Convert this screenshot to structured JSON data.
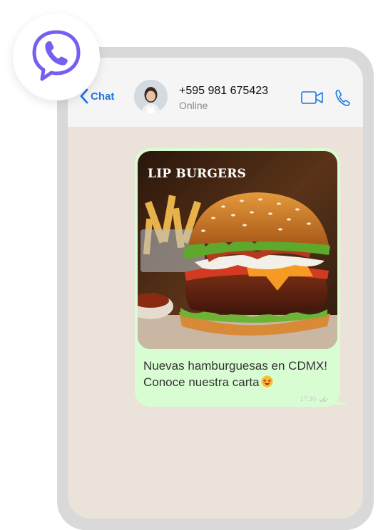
{
  "header": {
    "back_label": "Chat",
    "contact_name": "+595 981 675423",
    "contact_status": "Online"
  },
  "message": {
    "image_title": "LIP BURGERS",
    "text": "Nuevas hamburguesas en CDMX! Conoce nuestra carta",
    "time": "17:30"
  },
  "icons": {
    "app_logo": "viber-style-phone-bubble-icon",
    "back": "chevron-left-icon",
    "video": "video-camera-icon",
    "call": "phone-icon",
    "emoji": "star-struck-emoji-icon",
    "read_receipt": "double-check-icon"
  },
  "colors": {
    "accent": "#7360f2",
    "link": "#1c77e6",
    "bubble": "#d9fdd3",
    "chat_background": "#ebe2d9"
  }
}
